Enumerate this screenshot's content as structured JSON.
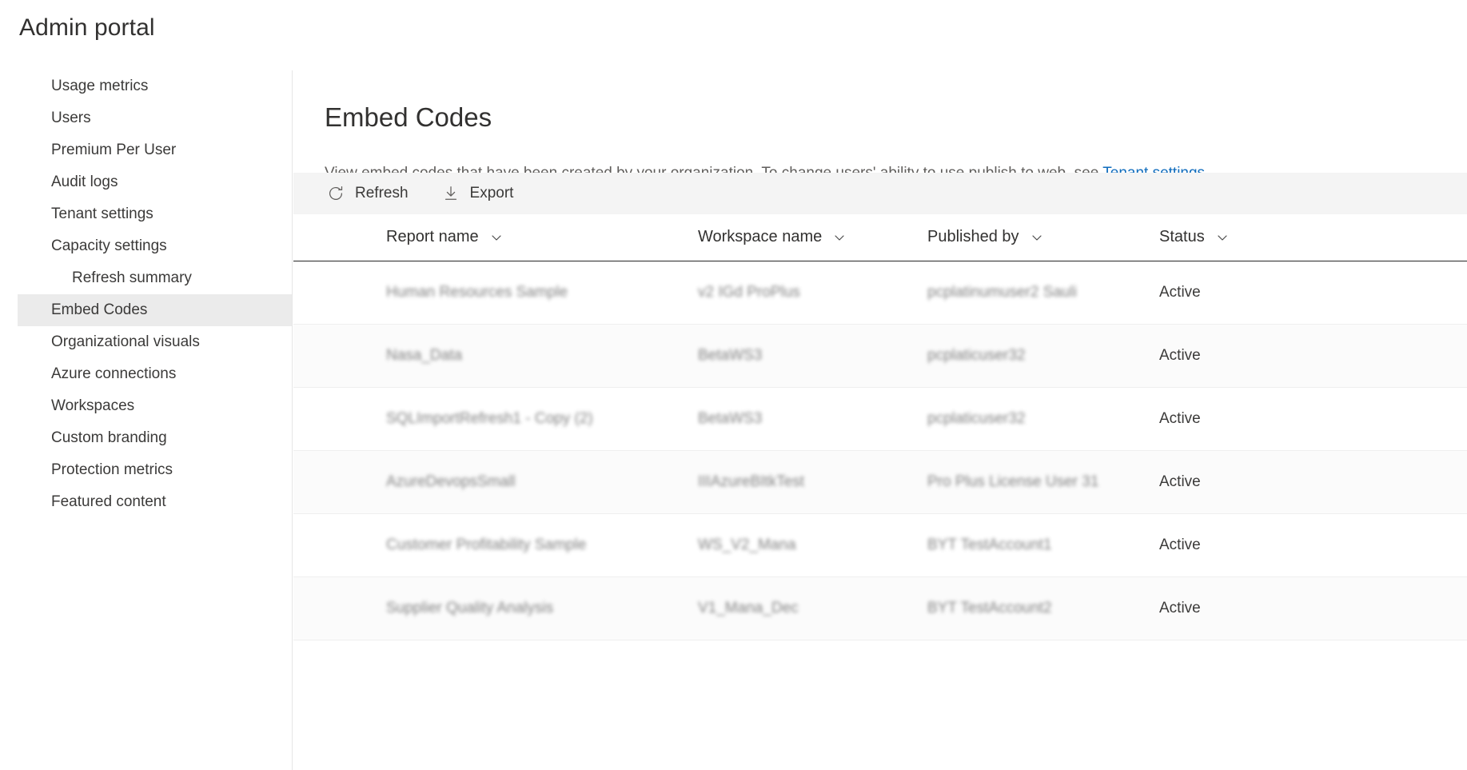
{
  "portal": {
    "title": "Admin portal"
  },
  "sidebar": {
    "items": [
      {
        "label": "Usage metrics",
        "level": 0,
        "selected": false
      },
      {
        "label": "Users",
        "level": 0,
        "selected": false
      },
      {
        "label": "Premium Per User",
        "level": 0,
        "selected": false
      },
      {
        "label": "Audit logs",
        "level": 0,
        "selected": false
      },
      {
        "label": "Tenant settings",
        "level": 0,
        "selected": false
      },
      {
        "label": "Capacity settings",
        "level": 0,
        "selected": false
      },
      {
        "label": "Refresh summary",
        "level": 1,
        "selected": false
      },
      {
        "label": "Embed Codes",
        "level": 0,
        "selected": true
      },
      {
        "label": "Organizational visuals",
        "level": 0,
        "selected": false
      },
      {
        "label": "Azure connections",
        "level": 0,
        "selected": false
      },
      {
        "label": "Workspaces",
        "level": 0,
        "selected": false
      },
      {
        "label": "Custom branding",
        "level": 0,
        "selected": false
      },
      {
        "label": "Protection metrics",
        "level": 0,
        "selected": false
      },
      {
        "label": "Featured content",
        "level": 0,
        "selected": false
      }
    ]
  },
  "main": {
    "title": "Embed Codes",
    "description_before": "View embed codes that have been created by your organization. To change users' ability to use publish to web, see ",
    "description_link": "Tenant settings",
    "description_after": ".",
    "link_color": "#0f6cbd"
  },
  "toolbar": {
    "refresh_label": "Refresh",
    "export_label": "Export",
    "background": "#f4f4f4"
  },
  "table": {
    "columns": [
      {
        "label": "Report name",
        "sortable": true
      },
      {
        "label": "Workspace name",
        "sortable": true
      },
      {
        "label": "Published by",
        "sortable": true
      },
      {
        "label": "Status",
        "sortable": true
      }
    ],
    "rows": [
      {
        "report_name": "Human Resources Sample",
        "workspace_name": "v2 IGd ProPlus",
        "published_by": "pcplatinumuser2 Sauli",
        "status": "Active",
        "redacted": true
      },
      {
        "report_name": "Nasa_Data",
        "workspace_name": "BetaWS3",
        "published_by": "pcplaticuser32",
        "status": "Active",
        "redacted": true
      },
      {
        "report_name": "SQLImportRefresh1 - Copy (2)",
        "workspace_name": "BetaWS3",
        "published_by": "pcplaticuser32",
        "status": "Active",
        "redacted": true
      },
      {
        "report_name": "AzureDevopsSmall",
        "workspace_name": "IIIAzureBItkTest",
        "published_by": "Pro Plus License User 31",
        "status": "Active",
        "redacted": true
      },
      {
        "report_name": "Customer Profitability Sample",
        "workspace_name": "WS_V2_Mana",
        "published_by": "BYT TestAccount1",
        "status": "Active",
        "redacted": true
      },
      {
        "report_name": "Supplier Quality Analysis",
        "workspace_name": "V1_Mana_Dec",
        "published_by": "BYT TestAccount2",
        "status": "Active",
        "redacted": true
      }
    ]
  }
}
